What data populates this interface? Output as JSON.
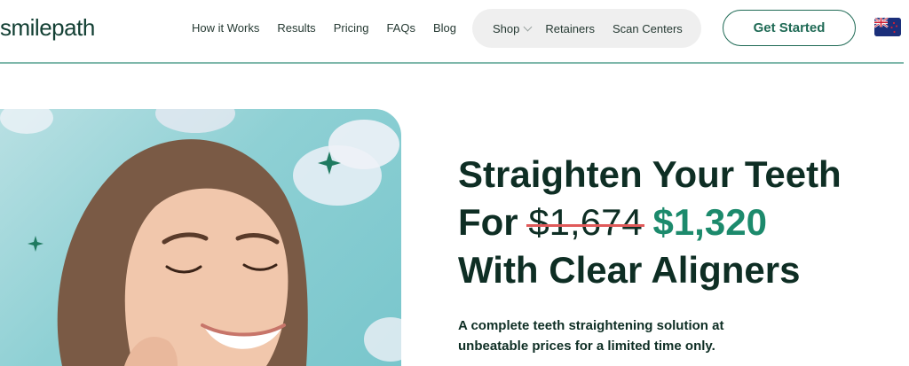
{
  "header": {
    "logo": "smilepath",
    "nav": [
      "How it Works",
      "Results",
      "Pricing",
      "FAQs",
      "Blog"
    ],
    "pill": {
      "shop": "Shop",
      "retainers": "Retainers",
      "scan_centers": "Scan Centers"
    },
    "cta": "Get Started",
    "flag_icon": "new-zealand-flag-icon"
  },
  "hero": {
    "headline_line1": "Straighten Your Teeth",
    "headline_for": "For",
    "old_price": "$1,674",
    "new_price": "$1,320",
    "headline_line3": "With Clear Aligners",
    "subtext": "A complete teeth straightening solution at unbeatable prices for a limited time only.",
    "accent_color": "#1c8a6c",
    "strike_color": "#e05a5a"
  }
}
